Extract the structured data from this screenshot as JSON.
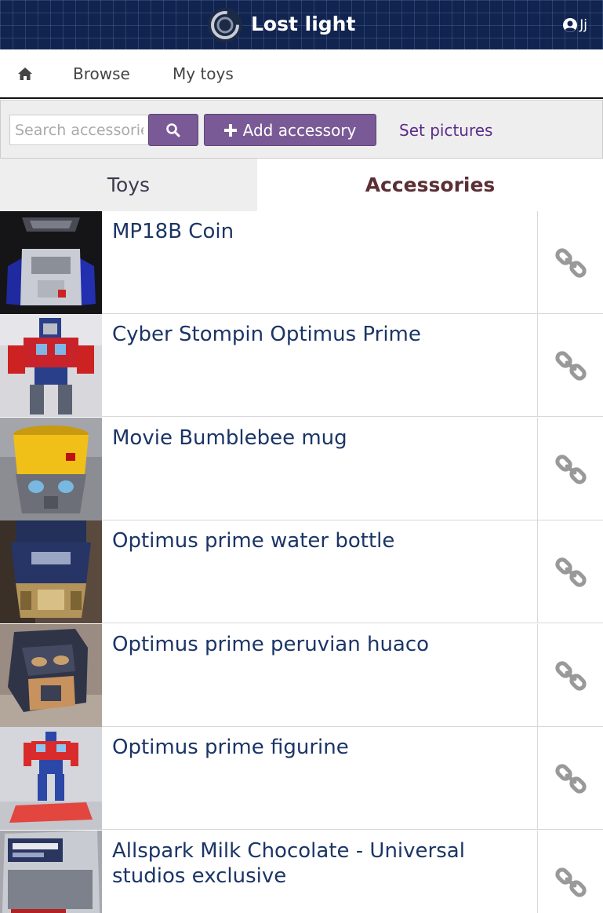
{
  "header": {
    "app_title": "Lost light",
    "user_name": "Jj",
    "bg_color": "#11244f"
  },
  "nav": {
    "home_icon": "home-icon",
    "browse_label": "Browse",
    "mytoys_label": "My toys"
  },
  "toolbar": {
    "search_placeholder": "Search accessories",
    "search_icon": "search-icon",
    "add_label": "Add accessory",
    "set_pictures_label": "Set pictures",
    "accent": "#7a5a96"
  },
  "tabs": [
    {
      "label": "Toys",
      "active": false
    },
    {
      "label": "Accessories",
      "active": true
    }
  ],
  "items": [
    {
      "title": "MP18B Coin",
      "link_icon": "chain-link-icon"
    },
    {
      "title": "Cyber Stompin Optimus Prime",
      "link_icon": "chain-link-icon"
    },
    {
      "title": "Movie Bumblebee mug",
      "link_icon": "chain-link-icon"
    },
    {
      "title": "Optimus prime water bottle",
      "link_icon": "chain-link-icon"
    },
    {
      "title": "Optimus prime peruvian huaco",
      "link_icon": "chain-link-icon"
    },
    {
      "title": "Optimus prime figurine",
      "link_icon": "chain-link-icon"
    },
    {
      "title": "Allspark Milk Chocolate - Universal studios exclusive",
      "link_icon": "chain-link-icon"
    }
  ]
}
